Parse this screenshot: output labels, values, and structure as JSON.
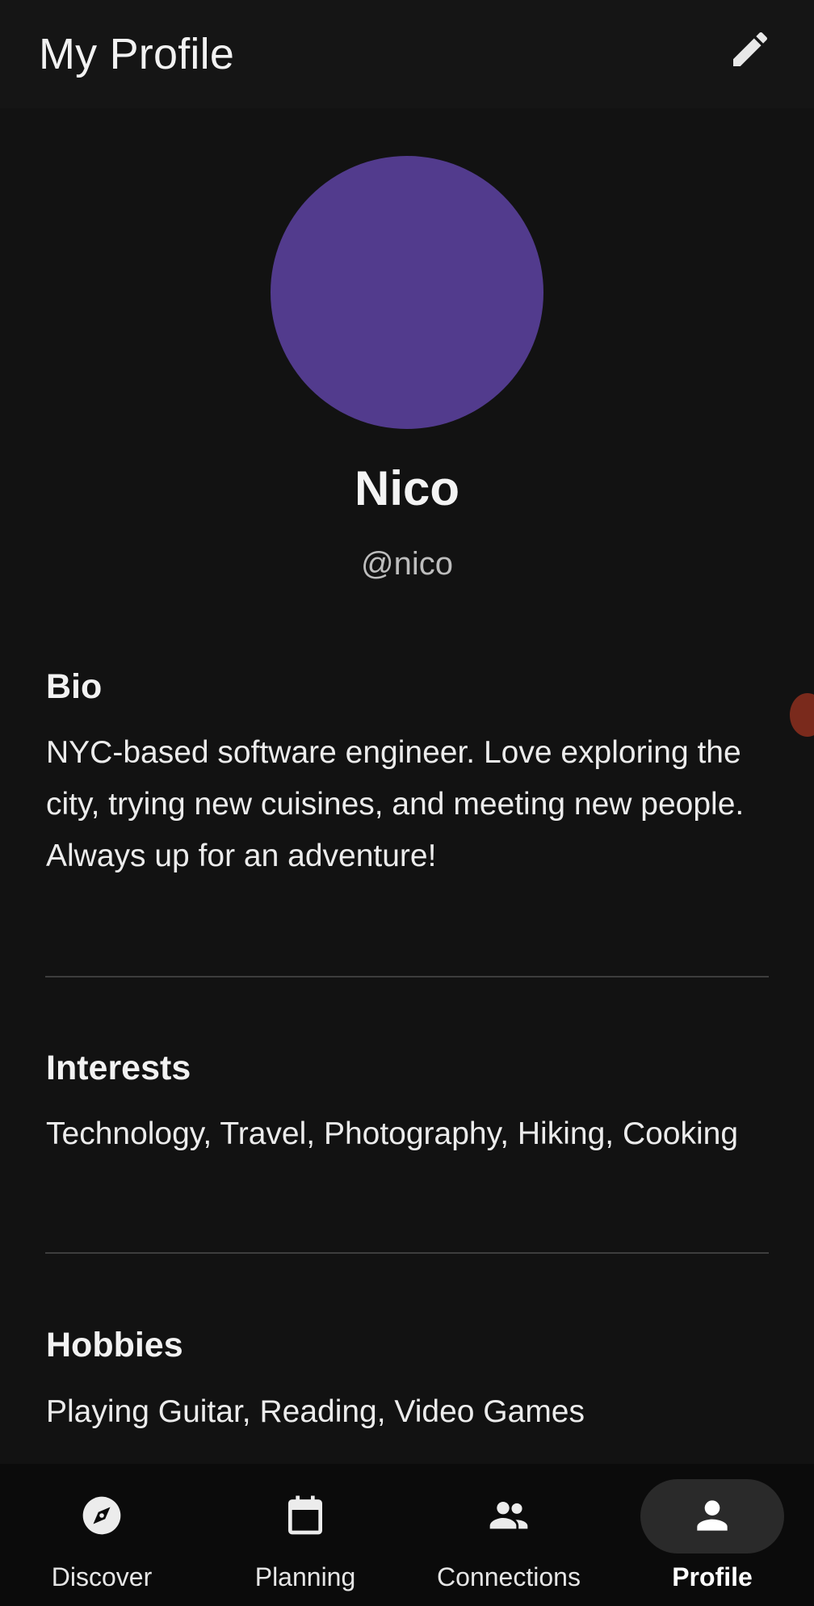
{
  "appbar": {
    "title": "My Profile",
    "edit_icon": "pencil-icon"
  },
  "profile": {
    "avatar_color": "#523b8d",
    "name": "Nico",
    "handle": "@nico"
  },
  "sections": [
    {
      "title": "Bio",
      "body": "NYC-based software engineer. Love exploring the city, trying new cuisines, and meeting new people. Always up for an adventure!"
    },
    {
      "title": "Interests",
      "body": "Technology, Travel, Photography, Hiking, Cooking"
    },
    {
      "title": "Hobbies",
      "body": "Playing Guitar, Reading, Video Games"
    }
  ],
  "nav": {
    "items": [
      {
        "label": "Discover",
        "icon": "compass-icon"
      },
      {
        "label": "Planning",
        "icon": "calendar-icon"
      },
      {
        "label": "Connections",
        "icon": "people-icon"
      },
      {
        "label": "Profile",
        "icon": "person-icon"
      }
    ],
    "active": "Profile"
  },
  "colors": {
    "background": "#121212",
    "appbar": "#151515",
    "nav_background": "#0b0b0b",
    "active_pill": "#2a2a2a",
    "divider": "#3d3d3d"
  }
}
